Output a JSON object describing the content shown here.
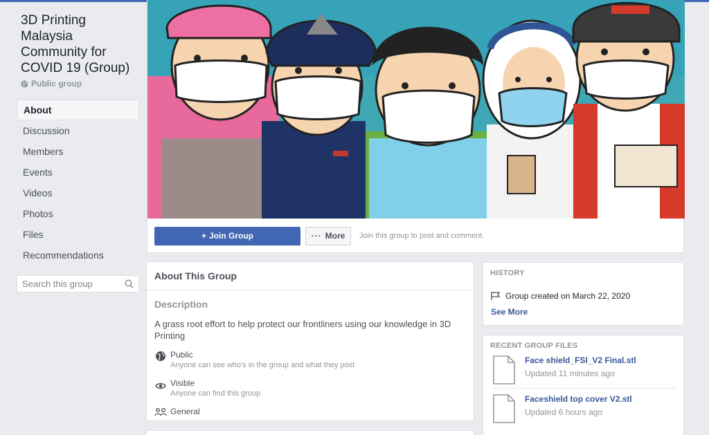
{
  "group": {
    "title": "3D Printing Malaysia Community for COVID 19 (Group)",
    "privacy": "Public group"
  },
  "nav": {
    "items": [
      {
        "label": "About",
        "active": true
      },
      {
        "label": "Discussion"
      },
      {
        "label": "Members"
      },
      {
        "label": "Events"
      },
      {
        "label": "Videos"
      },
      {
        "label": "Photos"
      },
      {
        "label": "Files"
      },
      {
        "label": "Recommendations"
      }
    ]
  },
  "search": {
    "placeholder": "Search this group"
  },
  "actions": {
    "join_label": "Join Group",
    "more_label": "More",
    "hint": "Join this group to post and comment."
  },
  "about": {
    "header": "About This Group",
    "description_label": "Description",
    "description": "A grass root effort to help protect our frontliners using our knowledge in 3D Printing",
    "public_title": "Public",
    "public_sub": "Anyone can see who's in the group and what they post",
    "visible_title": "Visible",
    "visible_sub": "Anyone can find this group",
    "general": "General"
  },
  "history": {
    "label": "HISTORY",
    "created": "Group created on March 22, 2020",
    "see_more": "See More"
  },
  "files": {
    "label": "RECENT GROUP FILES",
    "items": [
      {
        "name": "Face shield_FSI_V2 Final.stl",
        "updated": "Updated 11 minutes ago"
      },
      {
        "name": "Faceshield top cover V2.stl",
        "updated": "Updated 6 hours ago"
      }
    ]
  },
  "colors": {
    "brand": "#4267b2",
    "link": "#365899",
    "background": "#e9ebee"
  },
  "icons": [
    "globe-icon",
    "plus-icon",
    "ellipsis-icon",
    "search-icon",
    "eye-icon",
    "people-icon",
    "flag-icon",
    "file-icon"
  ]
}
